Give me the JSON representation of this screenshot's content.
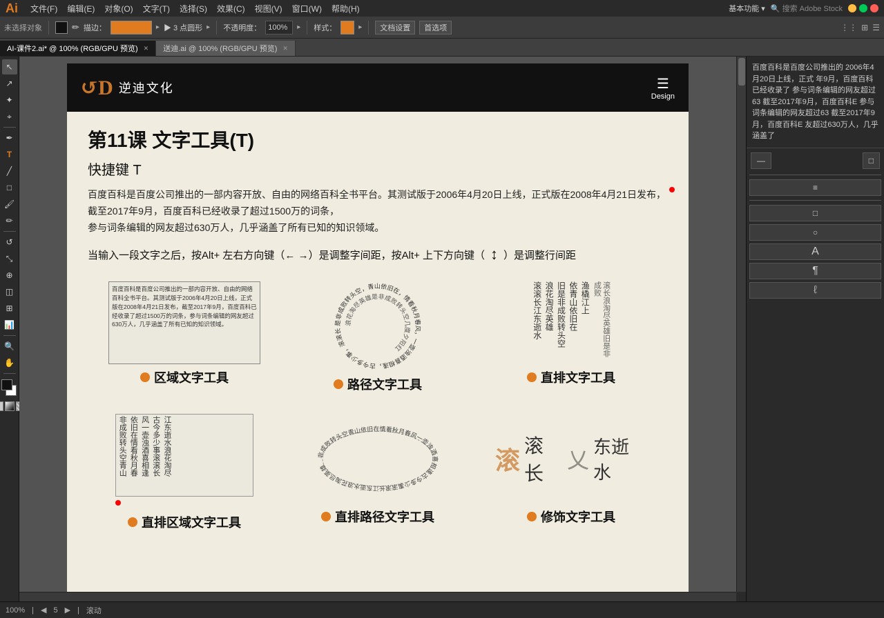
{
  "app": {
    "icon": "Ai",
    "title": "Adobe Illustrator"
  },
  "menu": {
    "items": [
      "文件(F)",
      "编辑(E)",
      "对象(O)",
      "文字(T)",
      "选择(S)",
      "效果(C)",
      "视图(V)",
      "窗口(W)",
      "帮助(H)"
    ]
  },
  "toolbar": {
    "no_selection": "未选择对象",
    "fill_label": "描边：",
    "points_label": "▶ 3 点圆形",
    "opacity_label": "不透明度：",
    "opacity_value": "100%",
    "style_label": "样式：",
    "doc_settings": "文档设置",
    "preferences": "首选项"
  },
  "tabs": [
    {
      "label": "AI-课件2.ai* @ 100% (RGB/GPU 预览)",
      "active": true
    },
    {
      "label": "送迪.ai @ 100% (RGB/GPU 预览)",
      "active": false
    }
  ],
  "document": {
    "header": {
      "logo_symbol": "D",
      "logo_cn": "逆迪文化",
      "menu_label": "Design"
    },
    "lesson": {
      "title": "第11课   文字工具(T)",
      "shortcut": "快捷键 T",
      "desc1": "百度百科是百度公司推出的一部内容开放、自由的网络百科全书平台。其测试版于2006年4月20日上线，正式版在2008年4月21日发布，",
      "desc2": "截至2017年9月，百度百科已经收录了超过1500万的词条，",
      "desc3": "参与词条编辑的网友超过630万人，几乎涵盖了所有已知的知识领域。",
      "instruction": "当输入一段文字之后，按Alt+ 左右方向键（← →）是调整字间距，按Alt+ 上下方向键（",
      "instruction2": "）是调整行间距"
    },
    "tools": [
      {
        "label": "区域文字工具",
        "type": "area"
      },
      {
        "label": "路径文字工具",
        "type": "path"
      },
      {
        "label": "直排文字工具",
        "type": "vertical"
      }
    ],
    "bottom_tools": [
      {
        "label": "直排区域文字工具",
        "type": "v-area"
      },
      {
        "label": "直排路径文字工具",
        "type": "v-path"
      },
      {
        "label": "修饰文字工具",
        "type": "touch"
      }
    ]
  },
  "right_panel": {
    "text": "百度百科是百度公司推出的 2006年4月20日上线，正式 年9月，百度百科已经收录了 参与词条编辑的网友超过63 截至2017年9月，百度百科E 参与词条编辑的网友超过63 截至2017年9月，百度百科E 友超过630万人，几乎涵盖了"
  },
  "status_bar": {
    "zoom": "100%",
    "page": "5",
    "position": "滚动"
  },
  "area_text_content": "百度百科是百度公司推出的一部内容开放、自由的网络百科全书平台。其测试版于2006年4月20日上线，正式版在2008年4月21日发布，截至2017年9月，百度百科已经收录了超过1500万的词条，参与词条编辑的网友超过630万人，几乎涵盖了所有已知的知识领域。",
  "path_text_content": "是非成败转头空，青山依旧在，情看秋月春风，一壶浊酒喜相逢，古今多少事，滚滚长江东逝水，浪花淘尽英雄，是非成败转头空，几度夕阳红。日夜渔船上，情看秋月换",
  "vertical_text_content": "滚滚长江东逝水浪花淘尽英雄旧是非成败转头空依青山依旧在",
  "icons": {
    "hamburger": "☰",
    "arrow_up_down": "↕",
    "arrow_lr": "↔"
  }
}
